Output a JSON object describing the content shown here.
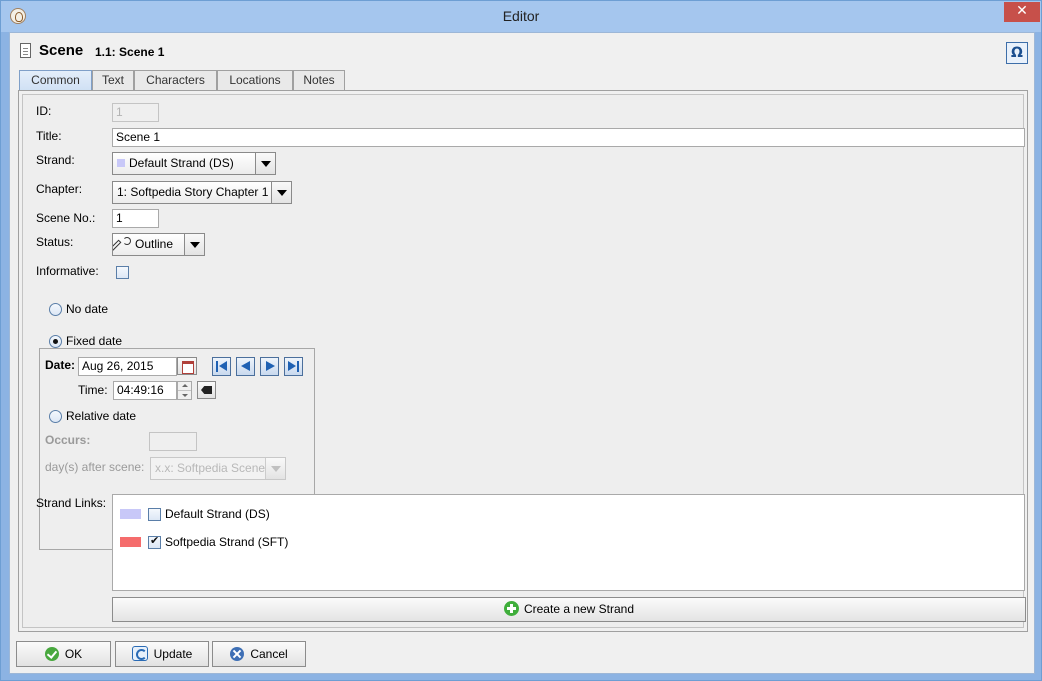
{
  "window": {
    "title": "Editor"
  },
  "header": {
    "title": "Scene",
    "subtitle": "1.1: Scene 1",
    "omega_symbol": "Ω"
  },
  "tabs": [
    {
      "label": "Common",
      "active": true
    },
    {
      "label": "Text"
    },
    {
      "label": "Characters"
    },
    {
      "label": "Locations"
    },
    {
      "label": "Notes"
    }
  ],
  "form": {
    "id_label": "ID:",
    "id_value": "1",
    "title_label": "Title:",
    "title_value": "Scene 1",
    "strand_label": "Strand:",
    "strand_value": "Default Strand (DS)",
    "chapter_label": "Chapter:",
    "chapter_value": "1: Softpedia Story Chapter 1",
    "scene_no_label": "Scene No.:",
    "scene_no_value": "1",
    "status_label": "Status:",
    "status_value": "Outline",
    "informative_label": "Informative:",
    "informative_checked": false
  },
  "date_section": {
    "no_date_label": "No date",
    "fixed_date_label": "Fixed date",
    "selected": "fixed",
    "date_label": "Date:",
    "date_value": "Aug 26, 2015",
    "time_label": "Time:",
    "time_value": "04:49:16",
    "relative_date_label": "Relative date",
    "occurs_label": "Occurs:",
    "occurs_value": "",
    "days_after_label": "day(s) after scene:",
    "days_after_scene_value": "x.x: Softpedia Scene"
  },
  "strand_links": {
    "label": "Strand Links:",
    "items": [
      {
        "name": "Default Strand (DS)",
        "color": "#c8c8f8",
        "checked": false
      },
      {
        "name": "Softpedia Strand (SFT)",
        "color": "#f56c6c",
        "checked": true
      }
    ],
    "create_button": "Create a new Strand"
  },
  "buttons": {
    "ok": "OK",
    "update": "Update",
    "cancel": "Cancel"
  },
  "colors": {
    "titlebar": "#a5c6ee",
    "close_button": "#c7504a",
    "accent": "#1f61b3"
  }
}
